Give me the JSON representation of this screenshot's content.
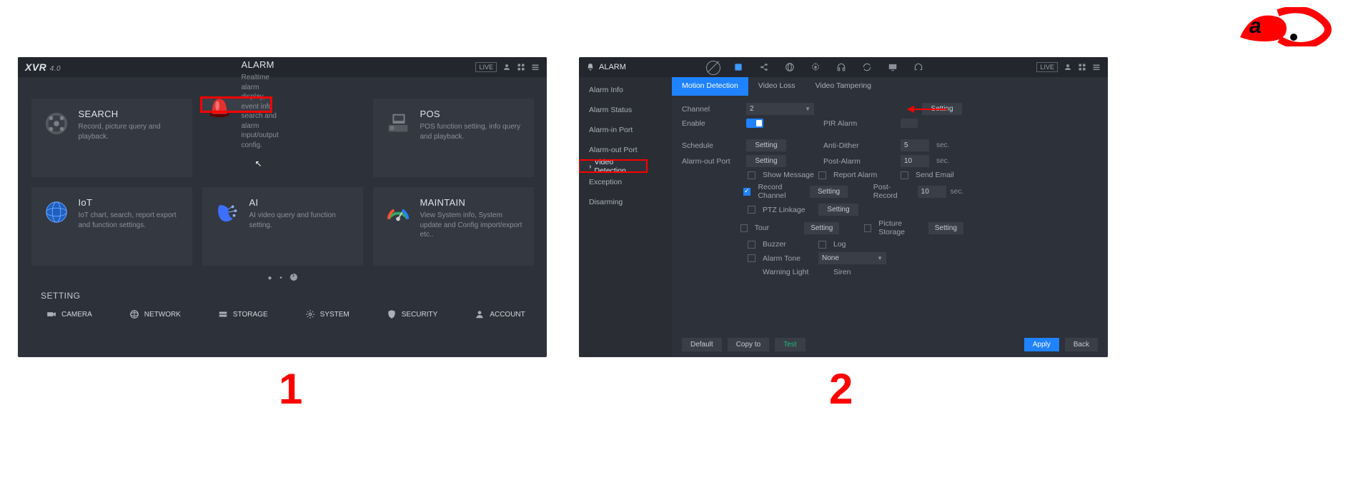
{
  "brand": "XVR",
  "brand_suffix": "4.0",
  "live_badge": "LIVE",
  "big_labels": {
    "left": "1",
    "right": "2"
  },
  "cards": [
    {
      "title": "SEARCH",
      "desc": "Record, picture query and playback."
    },
    {
      "title": "ALARM",
      "desc": "Realtime alarm display, event info search and alarm input/output config."
    },
    {
      "title": "POS",
      "desc": "POS function setting, info query and playback."
    },
    {
      "title": "IoT",
      "desc": "IoT chart, search, report export and function settings."
    },
    {
      "title": "AI",
      "desc": "AI video query and function setting."
    },
    {
      "title": "MAINTAIN",
      "desc": "View System info, System update and Config import/export etc.."
    }
  ],
  "setting_header": "SETTING",
  "setting_items": [
    {
      "label": "CAMERA"
    },
    {
      "label": "NETWORK"
    },
    {
      "label": "STORAGE"
    },
    {
      "label": "SYSTEM"
    },
    {
      "label": "SECURITY"
    },
    {
      "label": "ACCOUNT"
    }
  ],
  "right_header_title": "ALARM",
  "sidebar_items": [
    "Alarm Info",
    "Alarm Status",
    "Alarm-in Port",
    "Alarm-out Port",
    "Video Detection",
    "Exception",
    "Disarming"
  ],
  "tabs": [
    "Motion Detection",
    "Video Loss",
    "Video Tampering"
  ],
  "form": {
    "channel_label": "Channel",
    "channel_value": "2",
    "region_btn": "Setting",
    "enable_label": "Enable",
    "pir_label": "PIR Alarm",
    "schedule_label": "Schedule",
    "schedule_btn": "Setting",
    "antidither_label": "Anti-Dither",
    "antidither_value": "5",
    "sec": "sec.",
    "alarmout_label": "Alarm-out Port",
    "alarmout_btn": "Setting",
    "postalarm_label": "Post-Alarm",
    "postalarm_value": "10",
    "showmsg_label": "Show Message",
    "report_label": "Report Alarm",
    "sendemail_label": "Send Email",
    "recchan_label": "Record Channel",
    "recchan_btn": "Setting",
    "postrec_label": "Post-Record",
    "postrec_value": "10",
    "ptz_label": "PTZ Linkage",
    "ptz_btn": "Setting",
    "tour_label": "Tour",
    "tour_btn": "Setting",
    "picstore_label": "Picture Storage",
    "picstore_btn": "Setting",
    "buzzer_label": "Buzzer",
    "log_label": "Log",
    "alarmtone_label": "Alarm Tone",
    "alarmtone_value": "None",
    "warnlight_label": "Warning Light",
    "siren_label": "Siren"
  },
  "footer": {
    "default": "Default",
    "copyto": "Copy to",
    "test": "Test",
    "apply": "Apply",
    "back": "Back"
  }
}
